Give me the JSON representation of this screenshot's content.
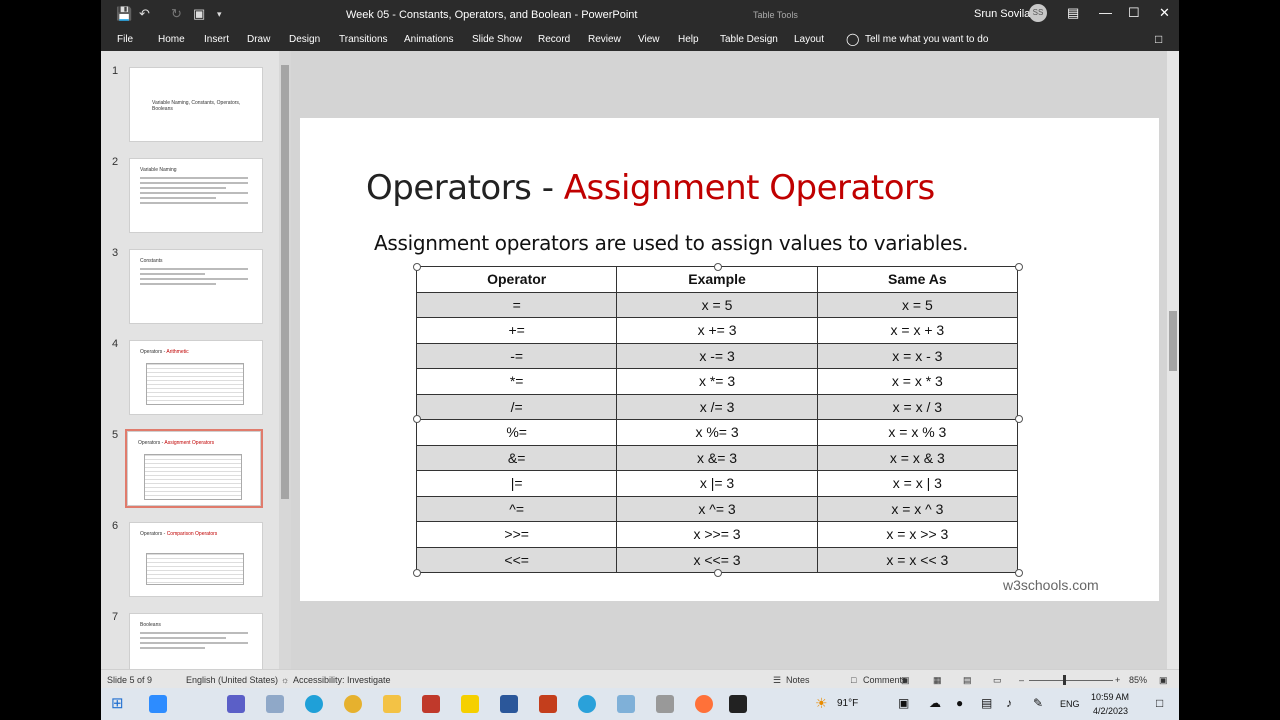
{
  "window": {
    "title": "Week 05 - Constants, Operators, and Boolean  -  PowerPoint",
    "context_tab": "Table Tools",
    "user_name": "Srun Sovila",
    "user_initials": "SS"
  },
  "ribbon": {
    "tabs": [
      "File",
      "Home",
      "Insert",
      "Draw",
      "Design",
      "Transitions",
      "Animations",
      "Slide Show",
      "Record",
      "Review",
      "View",
      "Help",
      "Table Design",
      "Layout"
    ],
    "tell_me": "Tell me what you want to do"
  },
  "thumbnails": [
    {
      "num": "1",
      "title": "Variable Naming, Constants, Operators, Booleans",
      "accent": ""
    },
    {
      "num": "2",
      "title": "Variable Naming",
      "accent": ""
    },
    {
      "num": "3",
      "title": "Constants",
      "accent": ""
    },
    {
      "num": "4",
      "title": "Operators - ",
      "accent": "Arithmetic"
    },
    {
      "num": "5",
      "title": "Operators - ",
      "accent": "Assignment Operators"
    },
    {
      "num": "6",
      "title": "Operators - ",
      "accent": "Comparison Operators"
    },
    {
      "num": "7",
      "title": "Booleans",
      "accent": ""
    }
  ],
  "slide": {
    "title_plain": "Operators - ",
    "title_accent": "Assignment Operators",
    "subtitle": "Assignment operators are used to assign values to variables.",
    "credit": "w3schools.com",
    "table": {
      "headers": [
        "Operator",
        "Example",
        "Same As"
      ],
      "rows": [
        [
          "=",
          "x = 5",
          "x = 5"
        ],
        [
          "+=",
          "x += 3",
          "x = x + 3"
        ],
        [
          "-=",
          "x -= 3",
          "x = x - 3"
        ],
        [
          "*=",
          "x *= 3",
          "x = x * 3"
        ],
        [
          "/=",
          "x /= 3",
          "x = x / 3"
        ],
        [
          "%=",
          "x %= 3",
          "x = x % 3"
        ],
        [
          "&=",
          "x &= 3",
          "x = x & 3"
        ],
        [
          "|=",
          "x |= 3",
          "x = x | 3"
        ],
        [
          "^=",
          "x ^= 3",
          "x = x ^ 3"
        ],
        [
          ">>=",
          "x >>= 3",
          "x = x >> 3"
        ],
        [
          "<<=",
          "x <<= 3",
          "x = x << 3"
        ]
      ]
    }
  },
  "status": {
    "slide_info": "Slide 5 of 9",
    "language": "English (United States)",
    "accessibility": "Accessibility: Investigate",
    "notes": "Notes",
    "comments": "Comments",
    "zoom": "85%"
  },
  "taskbar": {
    "weather": "91°F",
    "lang": "ENG",
    "time": "10:59 AM",
    "date": "4/2/2023"
  },
  "colors": {
    "accent_red": "#c00000",
    "selected_thumb": "#e07b6c",
    "table_band": "#dcdcdc",
    "chrome_dark": "#2b2b2b"
  }
}
